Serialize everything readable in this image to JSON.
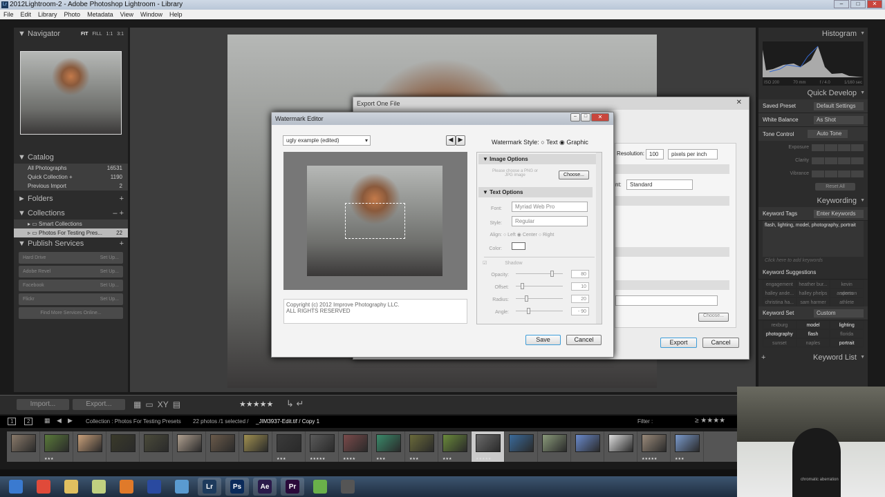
{
  "window": {
    "title": "2012Lightroom-2 - Adobe Photoshop Lightroom - Library",
    "app_icon": "Lr"
  },
  "menu": [
    "File",
    "Edit",
    "Library",
    "Photo",
    "Metadata",
    "View",
    "Window",
    "Help"
  ],
  "navigator": {
    "title": "Navigator",
    "zoom": [
      "FIT",
      "FILL",
      "1:1",
      "3:1"
    ]
  },
  "catalog": {
    "title": "Catalog",
    "items": [
      {
        "label": "All Photographs",
        "count": "16531"
      },
      {
        "label": "Quick Collection +",
        "count": "1190"
      },
      {
        "label": "Previous Import",
        "count": "2"
      }
    ]
  },
  "folders": {
    "title": "Folders"
  },
  "collections": {
    "title": "Collections",
    "items": [
      {
        "label": "Smart Collections",
        "count": ""
      },
      {
        "label": "Photos For Testing Pres...",
        "count": "22"
      }
    ]
  },
  "publish": {
    "title": "Publish Services",
    "items": [
      {
        "label": "Hard Drive",
        "action": "Set Up..."
      },
      {
        "label": "Adobe Revel",
        "action": "Set Up..."
      },
      {
        "label": "Facebook",
        "action": "Set Up..."
      },
      {
        "label": "Flickr",
        "action": "Set Up..."
      }
    ],
    "more": "Find More Services Online..."
  },
  "histogram": {
    "title": "Histogram",
    "iso": "ISO 200",
    "focal": "70 mm",
    "aperture": "f / 4.0",
    "shutter": "1/160 sec"
  },
  "quick_develop": {
    "title": "Quick Develop",
    "saved_preset_label": "Saved Preset",
    "saved_preset": "Default Settings",
    "wb_label": "White Balance",
    "wb": "As Shot",
    "tone_label": "Tone Control",
    "auto_tone": "Auto Tone",
    "sliders": [
      "Exposure",
      "Clarity",
      "Vibrance"
    ],
    "reset": "Reset All"
  },
  "keywording": {
    "title": "Keywording",
    "tags_label": "Keyword Tags",
    "tags_mode": "Enter Keywords",
    "tags": "flash, lighting, model, photography, portrait",
    "add_placeholder": "Click here to add keywords",
    "suggestions_label": "Keyword Suggestions",
    "suggestions": [
      "engagement",
      "heather bur...",
      "kevin anderson",
      "halley ande...",
      "halley phelps",
      "sports",
      "christina ha...",
      "sam harmer",
      "athlete"
    ],
    "set_label": "Keyword Set",
    "set": "Custom",
    "set_items": [
      {
        "t": "rexburg",
        "on": false
      },
      {
        "t": "model",
        "on": true
      },
      {
        "t": "lighting",
        "on": true
      },
      {
        "t": "photography",
        "on": true
      },
      {
        "t": "flash",
        "on": true
      },
      {
        "t": "florida",
        "on": false
      },
      {
        "t": "sunset",
        "on": false
      },
      {
        "t": "naples",
        "on": false
      },
      {
        "t": "portrait",
        "on": true
      }
    ]
  },
  "keyword_list": {
    "title": "Keyword List"
  },
  "toolbar": {
    "import": "Import...",
    "export": "Export...",
    "rating": "★★★★★"
  },
  "filmstrip": {
    "pages": [
      "1",
      "2"
    ],
    "source": "Collection : Photos For Testing Presets",
    "info": "22 photos /1 selected /",
    "file": "_JIM3937-Edit.tif / Copy 1",
    "filter_label": "Filter :",
    "filter_stars": "≥ ★★★★",
    "ratings": [
      "",
      "★★★",
      "",
      "",
      "",
      "",
      "",
      "",
      "★★★",
      "★★★★★",
      "★★★★",
      "★★★",
      "★★★",
      "★★★",
      "★★★★★",
      "",
      "",
      "",
      "",
      "★★★★★",
      "★★★"
    ],
    "selected_index": 14
  },
  "export_dialog": {
    "title": "Export One File",
    "resolution_label": "Resolution:",
    "resolution": "100",
    "resolution_unit": "pixels per inch",
    "intent_label": "nt:",
    "intent": "Standard",
    "choose": "Choose...",
    "export": "Export",
    "cancel": "Cancel"
  },
  "watermark": {
    "title": "Watermark Editor",
    "preset": "ugly example (edited)",
    "style_label": "Watermark Style:",
    "style_text": "Text",
    "style_graphic": "Graphic",
    "style_selected": "Graphic",
    "image_options": "Image Options",
    "choose_hint": "Please choose a PNG or JPG image",
    "choose": "Choose...",
    "text_options": "Text Options",
    "font_label": "Font:",
    "font": "Myriad Web Pro",
    "style_l": "Style:",
    "style": "Regular",
    "align_label": "Align:",
    "align": [
      "Left",
      "Center",
      "Right"
    ],
    "align_selected": "Center",
    "color_label": "Color:",
    "shadow": "Shadow",
    "opacity_label": "Opacity:",
    "opacity": "80",
    "offset_label": "Offset:",
    "offset": "10",
    "radius_label": "Radius:",
    "radius": "20",
    "angle_label": "Angle:",
    "angle": "- 90",
    "copyright": "Copyright (c) 2012 Improve Photography LLC.\nALL RIGHTS RESERVED",
    "save": "Save",
    "cancel": "Cancel"
  },
  "taskbar": [
    "Start",
    "Chrome",
    "Explorer",
    "Notes",
    "Firefox",
    "Audio",
    "Files",
    "Lr",
    "Ps",
    "Ae",
    "Pr",
    "Evernote",
    "Camera"
  ],
  "webcam_shirt": "chromatic aberration"
}
